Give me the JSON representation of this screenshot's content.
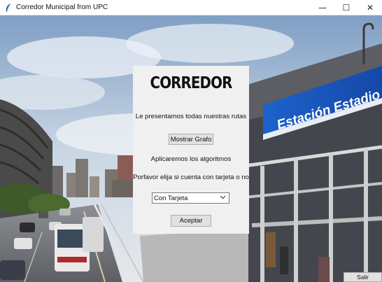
{
  "window": {
    "title": "Corredor Municipal from UPC",
    "minimize_glyph": "—",
    "maximize_glyph": "☐",
    "close_glyph": "✕",
    "app_icon": "feather-icon"
  },
  "background": {
    "sign_text": "Estación Estadio Naci",
    "sign_color": "#1a5fc9"
  },
  "panel": {
    "heading": "CORREDOR",
    "intro": "Le presentamos todas nuestras rutas",
    "show_graph_button": "Mostrar Grafo",
    "algorithms_text": "Aplicaremos los algoritmos",
    "card_prompt": "Porfavor elija si cuenta con tarjeta o no",
    "card_select_value": "Con Tarjeta",
    "accept_button": "Aceptar"
  },
  "exit_button": "Salir"
}
